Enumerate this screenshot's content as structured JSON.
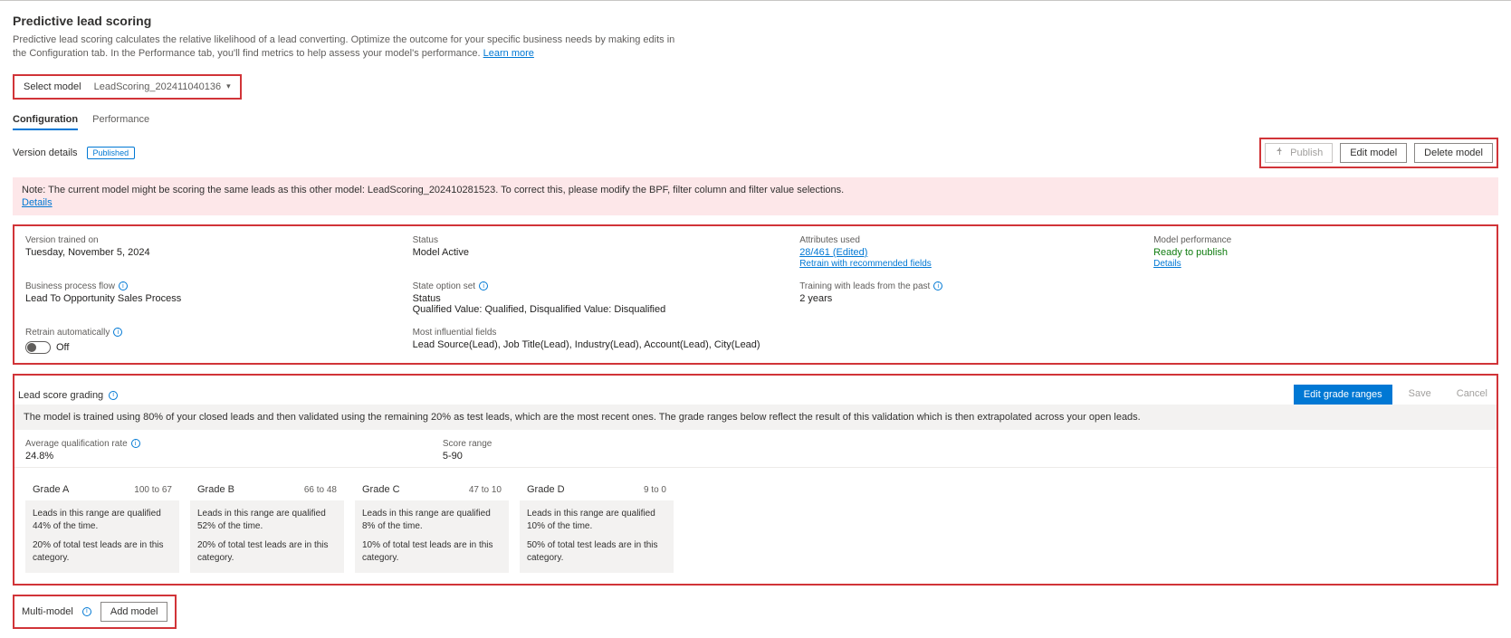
{
  "header": {
    "title": "Predictive lead scoring",
    "description": "Predictive lead scoring calculates the relative likelihood of a lead converting. Optimize the outcome for your specific business needs by making edits in the Configuration tab. In the Performance tab, you'll find metrics to help assess your model's performance.",
    "learn_more": "Learn more"
  },
  "model_select": {
    "label": "Select model",
    "value": "LeadScoring_202411040136"
  },
  "tabs": {
    "configuration": "Configuration",
    "performance": "Performance"
  },
  "version": {
    "details_label": "Version details",
    "badge": "Published"
  },
  "actions": {
    "publish": "Publish",
    "edit": "Edit model",
    "delete": "Delete model"
  },
  "alert": {
    "text": "Note: The current model might be scoring the same leads as this other model: LeadScoring_202410281523. To correct this, please modify the BPF, filter column and filter value selections.",
    "details": "Details"
  },
  "details": {
    "trained_on_label": "Version trained on",
    "trained_on_value": "Tuesday, November 5, 2024",
    "status_label": "Status",
    "status_value": "Model Active",
    "attributes_label": "Attributes used",
    "attributes_value": "28/461 (Edited)",
    "attributes_link": "Retrain with recommended fields",
    "performance_label": "Model performance",
    "performance_value": "Ready to publish",
    "performance_link": "Details",
    "bpf_label": "Business process flow",
    "bpf_value": "Lead To Opportunity Sales Process",
    "state_opt_label": "State option set",
    "state_opt_value1": "Status",
    "state_opt_value2": "Qualified Value: Qualified, Disqualified Value: Disqualified",
    "training_past_label": "Training with leads from the past",
    "training_past_value": "2 years",
    "retrain_label": "Retrain automatically",
    "retrain_value": "Off",
    "influential_label": "Most influential fields",
    "influential_value": "Lead Source(Lead), Job Title(Lead), Industry(Lead), Account(Lead), City(Lead)"
  },
  "grading": {
    "title": "Lead score grading",
    "edit_btn": "Edit grade ranges",
    "save": "Save",
    "cancel": "Cancel",
    "info": "The model is trained using 80% of your closed leads and then validated using the remaining 20% as test leads, which are the most recent ones. The grade ranges below reflect the result of this validation which is then extrapolated across your open leads.",
    "qual_rate_label": "Average qualification rate",
    "qual_rate_value": "24.8%",
    "score_range_label": "Score range",
    "score_range_value": "5-90",
    "grades": [
      {
        "name": "Grade A",
        "range": "100 to 67",
        "line1": "Leads in this range are qualified 44% of the time.",
        "line2": "20% of total test leads are in this category."
      },
      {
        "name": "Grade B",
        "range": "66 to 48",
        "line1": "Leads in this range are qualified 52% of the time.",
        "line2": "20% of total test leads are in this category."
      },
      {
        "name": "Grade C",
        "range": "47 to 10",
        "line1": "Leads in this range are qualified 8% of the time.",
        "line2": "10% of total test leads are in this category."
      },
      {
        "name": "Grade D",
        "range": "9 to 0",
        "line1": "Leads in this range are qualified 10% of the time.",
        "line2": "50% of total test leads are in this category."
      }
    ]
  },
  "multimodel": {
    "label": "Multi-model",
    "add": "Add model"
  }
}
